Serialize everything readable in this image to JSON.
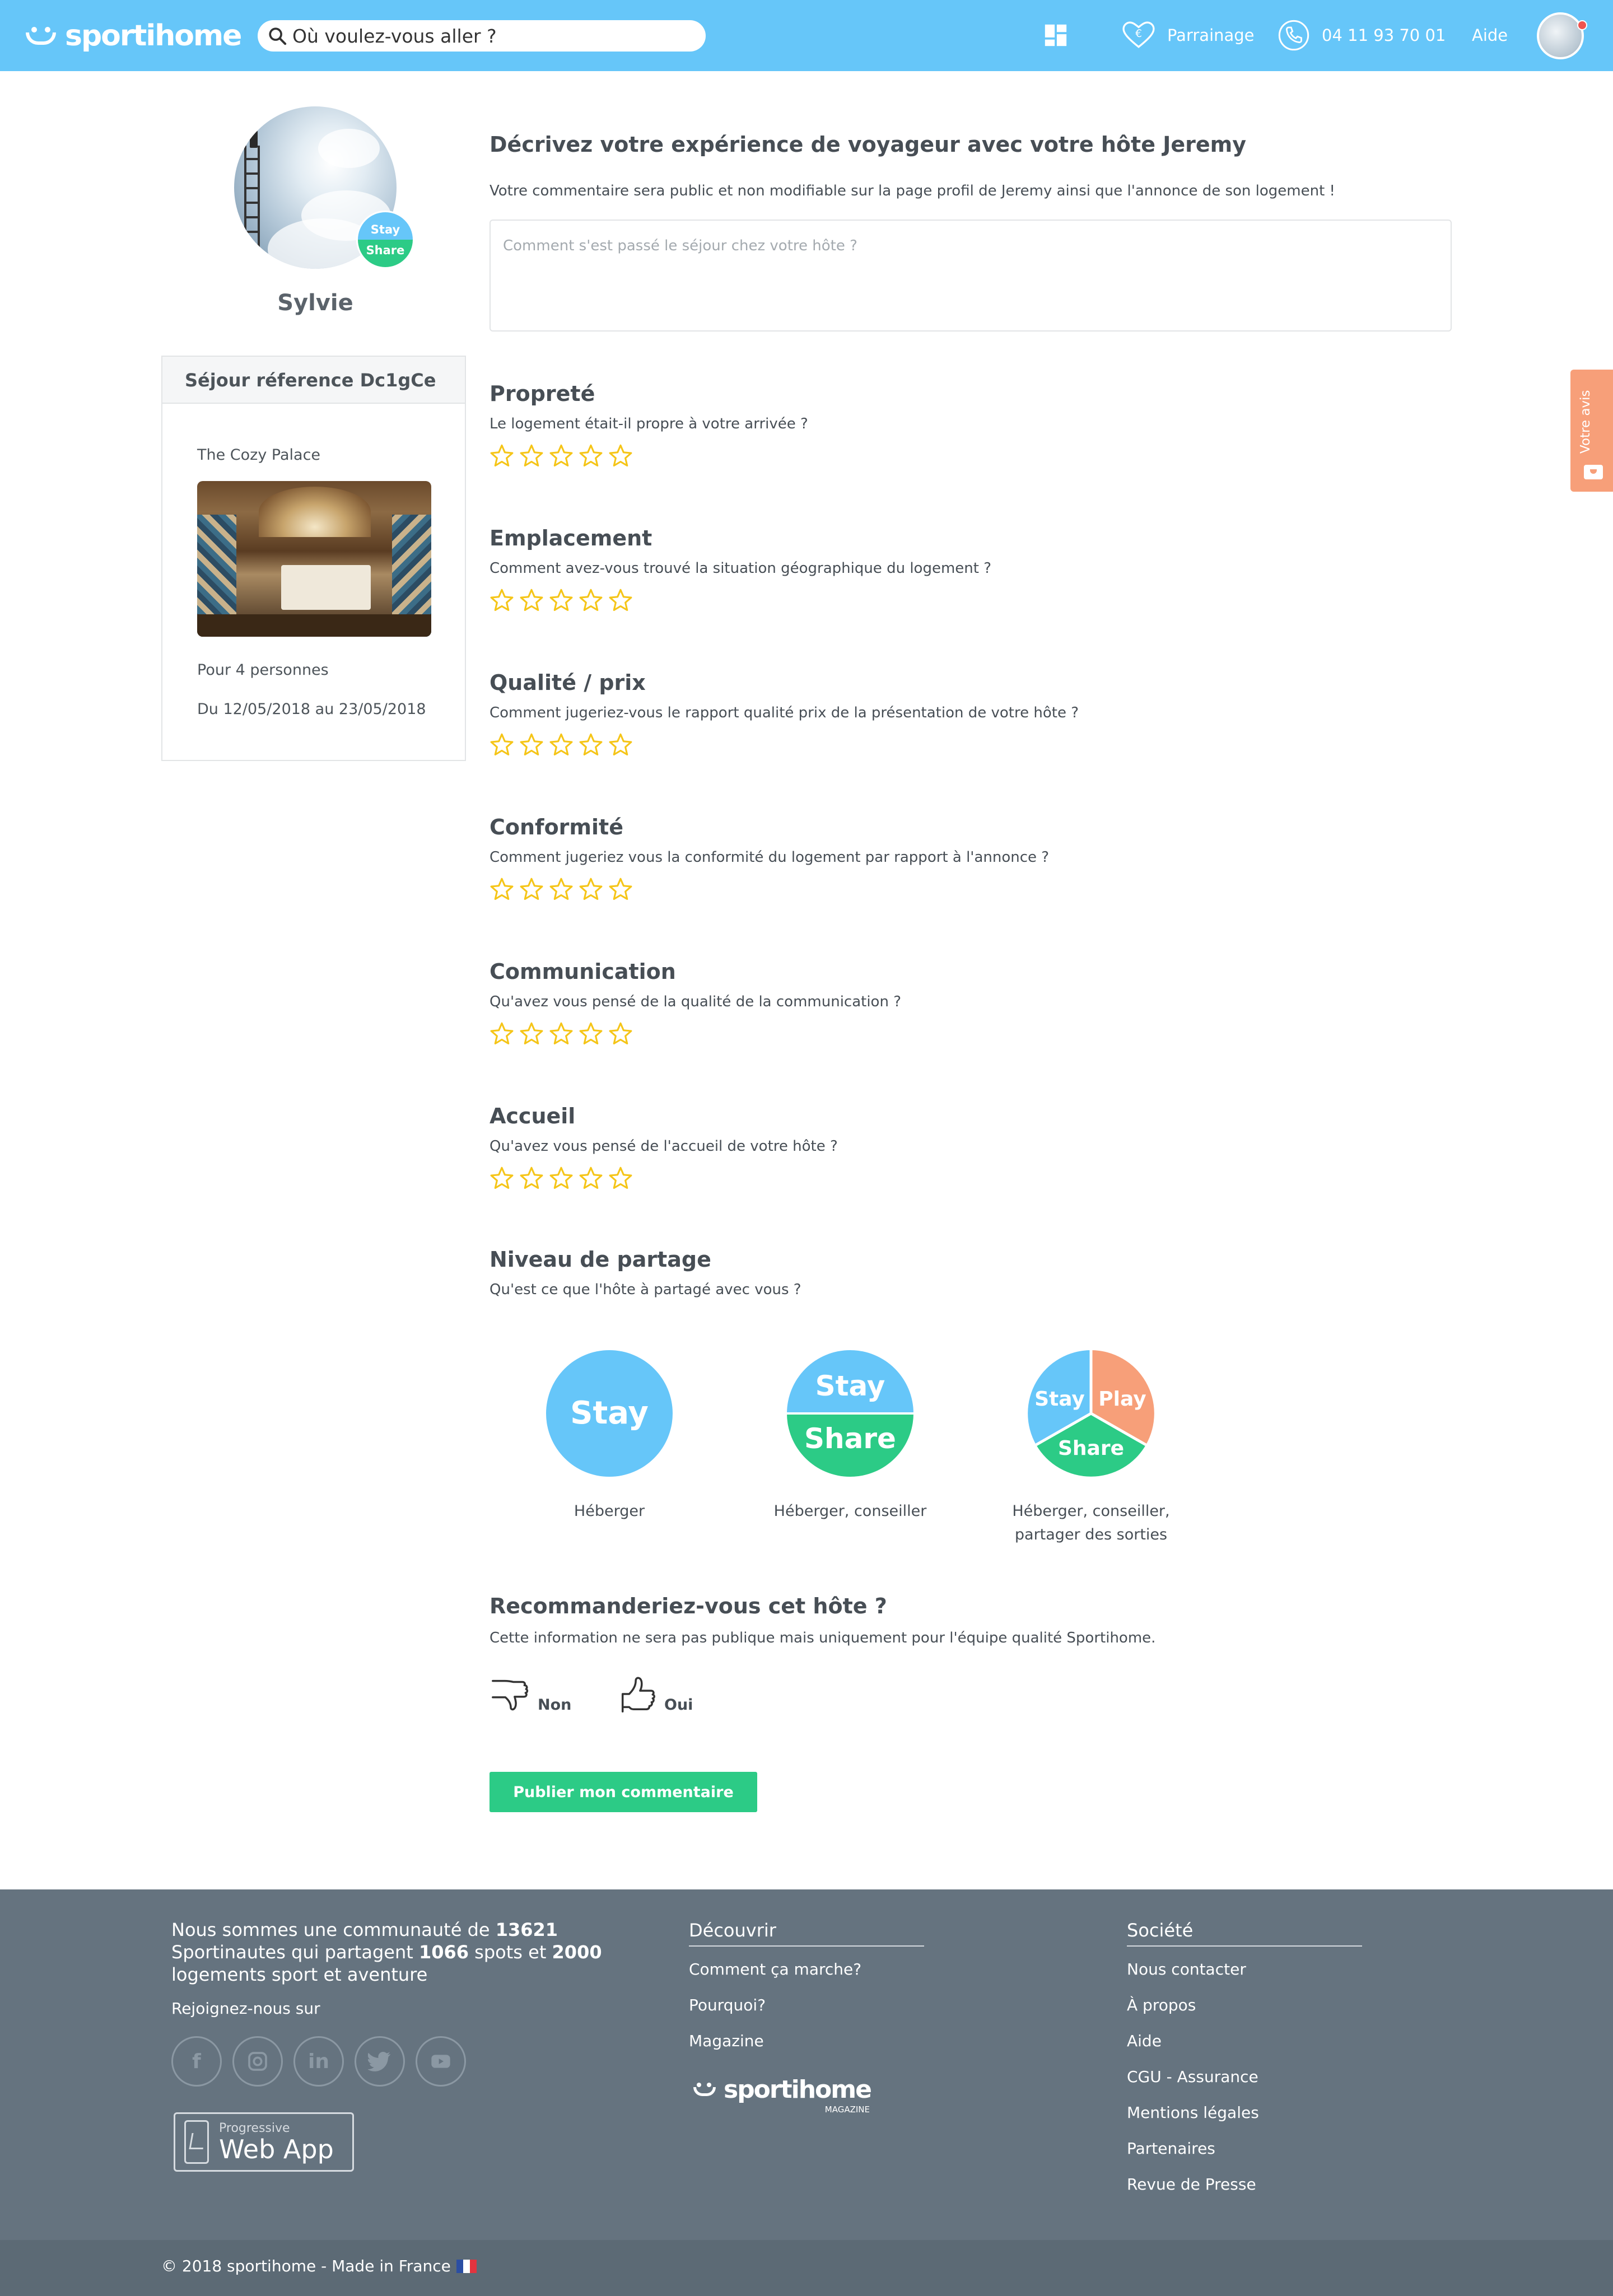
{
  "header": {
    "logo_text": "sportihome",
    "search_placeholder": "Où voulez-vous aller ?",
    "referral_label": "Parrainage",
    "phone": "04 11 93 70 01",
    "help_label": "Aide"
  },
  "host": {
    "name": "Sylvie",
    "badge_top": "Stay",
    "badge_bottom": "Share"
  },
  "stay": {
    "reference_label": "Séjour réference Dc1gCe",
    "property_name": "The Cozy Palace",
    "guests": "Pour 4 personnes",
    "dates": "Du 12/05/2018 au 23/05/2018"
  },
  "review": {
    "title": "Décrivez votre expérience de voyageur avec votre hôte Jeremy",
    "note": "Votre commentaire sera public et non modifiable sur la page profil de Jeremy ainsi que l'annonce de son logement !",
    "placeholder": "Comment s'est passé le séjour chez votre hôte ?"
  },
  "criteria": [
    {
      "title": "Propreté",
      "question": "Le logement était-il propre à votre arrivée ?"
    },
    {
      "title": "Emplacement",
      "question": "Comment avez-vous trouvé la situation géographique du logement ?"
    },
    {
      "title": "Qualité / prix",
      "question": "Comment jugeriez-vous le rapport qualité prix de la présentation de votre hôte ?"
    },
    {
      "title": "Conformité",
      "question": "Comment jugeriez vous la conformité du logement par rapport à l'annonce ?"
    },
    {
      "title": "Communication",
      "question": "Qu'avez vous pensé de la qualité de la communication ?"
    },
    {
      "title": "Accueil",
      "question": "Qu'avez vous pensé de l'accueil de votre hôte ?"
    }
  ],
  "sharing": {
    "title": "Niveau de partage",
    "question": "Qu'est ce que l'hôte à partagé avec vous ?",
    "levels": [
      {
        "circle_text": [
          "Stay"
        ],
        "label": "Héberger"
      },
      {
        "circle_text": [
          "Stay",
          "Share"
        ],
        "label": "Héberger, conseiller"
      },
      {
        "circle_text": [
          "Stay",
          "Play",
          "Share"
        ],
        "label": "Héberger, conseiller, partager des sorties"
      }
    ]
  },
  "recommend": {
    "title": "Recommanderiez-vous cet hôte ?",
    "note": "Cette information ne sera pas publique mais uniquement pour l'équipe qualité Sportihome.",
    "no_label": "Non",
    "yes_label": "Oui"
  },
  "publish_label": "Publier mon commentaire",
  "side_tab_label": "Votre avis",
  "colors": {
    "header": "#66c6f9",
    "stay": "#66c6f9",
    "share": "#2ccb86",
    "play": "#f79f79",
    "star": "#f5c518",
    "footer": "#65737f"
  },
  "footer": {
    "community_prefix": "Nous sommes une communauté de",
    "members": "13621",
    "community_mid1": "Sportinautes qui partagent",
    "spots": "1066",
    "community_mid2": "spots et",
    "homes": "2000",
    "community_suffix": "logements sport et aventure",
    "join_label": "Rejoignez-nous sur",
    "socials": [
      "facebook-icon",
      "instagram-icon",
      "linkedin-icon",
      "twitter-icon",
      "youtube-icon"
    ],
    "webapp_small": "Progressive",
    "webapp_big": "Web App",
    "discover_title": "Découvrir",
    "discover_links": [
      "Comment ça marche?",
      "Pourquoi?",
      "Magazine"
    ],
    "magazine_logo": "sportihome",
    "magazine_sub": "MAGAZINE",
    "company_title": "Société",
    "company_links": [
      "Nous contacter",
      "À propos",
      "Aide",
      "CGU - Assurance",
      "Mentions légales",
      "Partenaires",
      "Revue de Presse"
    ],
    "copyright": "© 2018 sportihome - Made in France"
  }
}
